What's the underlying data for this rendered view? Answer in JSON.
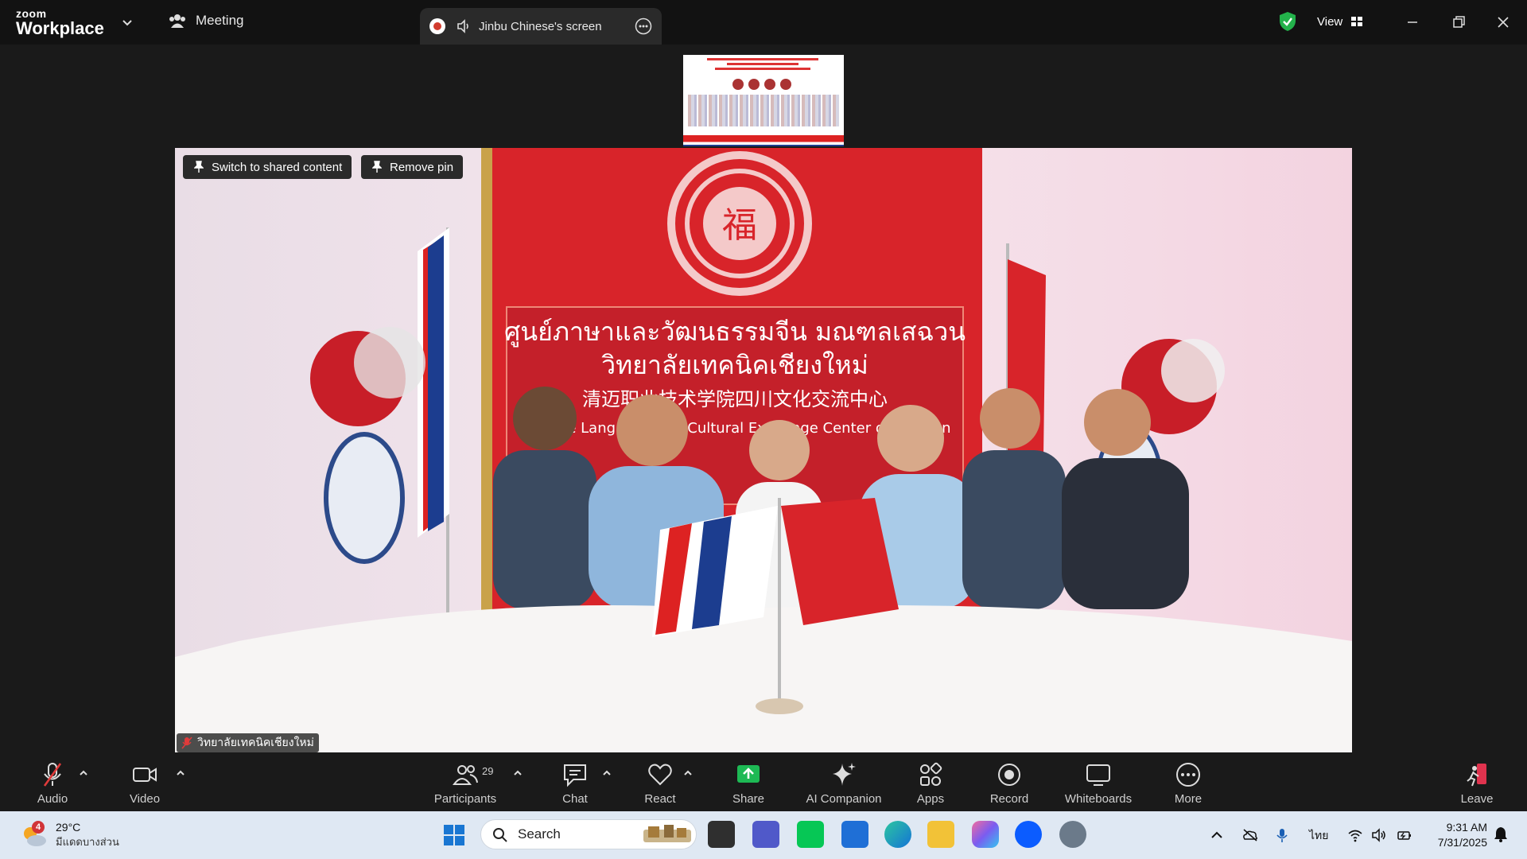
{
  "titlebar": {
    "logo_small": "zoom",
    "logo_big": "Workplace",
    "meeting_label": "Meeting",
    "tab_label": "Jinbu Chinese's screen",
    "view_label": "View"
  },
  "shared_thumbnail": {
    "description_hidden": ""
  },
  "video": {
    "pin_buttons": [
      "Switch to shared content",
      "Remove pin"
    ],
    "participant_name": "วิทยาลัยเทคนิคเชียงใหม่",
    "banner_thai_1": "ศูนย์ภาษาและวัฒนธรรมจีน มณฑลเสฉวน",
    "banner_thai_2": "วิทยาลัยเทคนิคเชียงใหม่",
    "banner_chinese": "清迈职业技术学院四川文化交流中心",
    "banner_english": "Chinese Language and Cultural Exchange Center of Sichuan",
    "seal_char": "福"
  },
  "toolbar": {
    "audio": "Audio",
    "video": "Video",
    "participants": "Participants",
    "participants_count": "29",
    "chat": "Chat",
    "react": "React",
    "share": "Share",
    "ai_companion": "AI Companion",
    "apps": "Apps",
    "record": "Record",
    "whiteboards": "Whiteboards",
    "more": "More",
    "leave": "Leave",
    "colors": {
      "share_green": "#1db954",
      "leave_red": "#e0334e"
    }
  },
  "taskbar": {
    "weather_badge": "4",
    "weather_temp": "29°C",
    "weather_desc": "มีแดดบางส่วน",
    "search_label": "Search",
    "lang": "ไทย",
    "time": "9:31 AM",
    "date": "7/31/2025"
  }
}
